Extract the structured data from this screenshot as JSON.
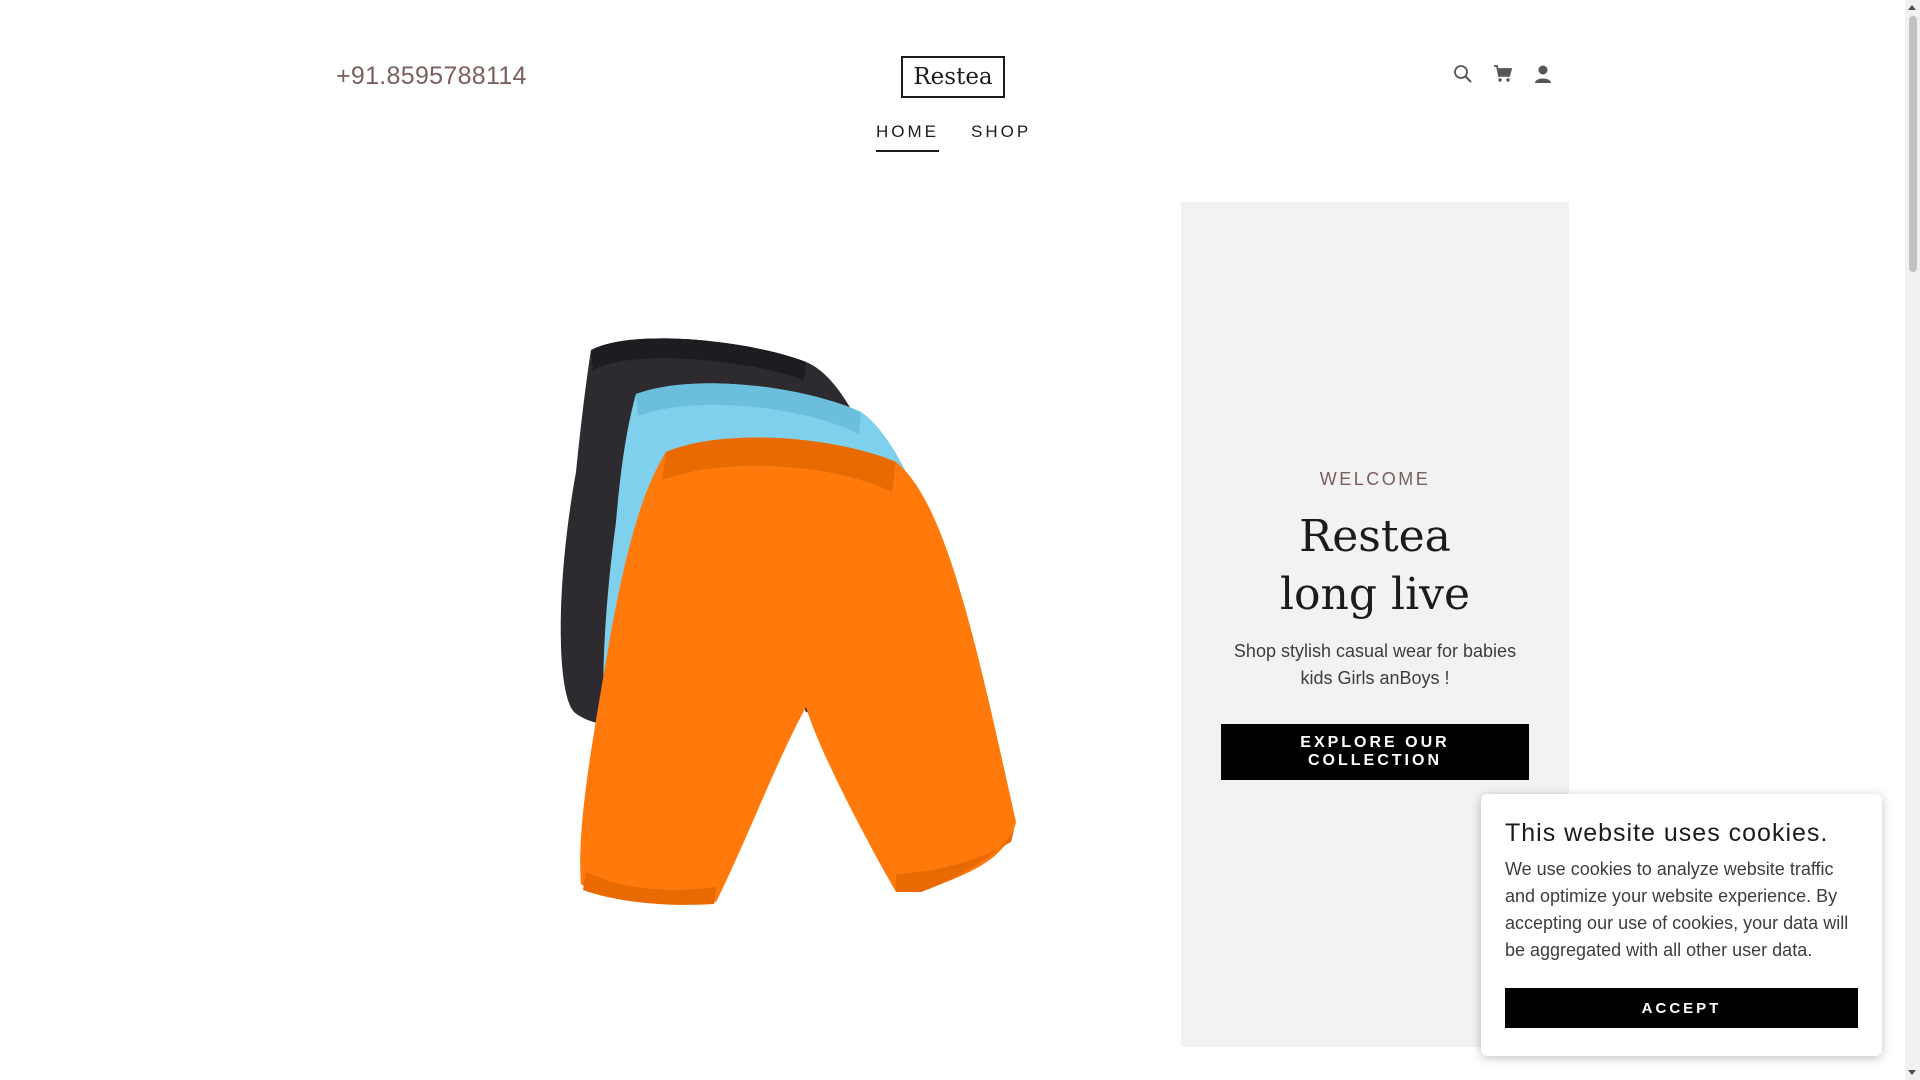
{
  "header": {
    "phone": "+91.8595788114",
    "logo": "Restea",
    "icons": [
      "search-icon",
      "cart-icon",
      "account-icon"
    ]
  },
  "nav": {
    "items": [
      {
        "label": "HOME",
        "active": true
      },
      {
        "label": "SHOP",
        "active": false
      }
    ]
  },
  "hero": {
    "image": "three-shorts-black-blue-orange",
    "welcome": "WELCOME",
    "headline_line1": "Restea",
    "headline_line2": "long live",
    "tagline_line1": "Shop stylish casual wear for babies",
    "tagline_line2": "kids Girls anBoys !",
    "button_line1": "EXPLORE OUR",
    "button_line2": "COLLECTION"
  },
  "cookie": {
    "title": "This website uses cookies.",
    "body": "We use cookies to analyze website traffic and optimize your website experience. By accepting our use of cookies, your data will be aggregated with all other user data.",
    "accept": "ACCEPT"
  },
  "colors": {
    "accent_text": "#7a5f5f",
    "panel_bg": "#f2f2f2",
    "button_bg": "#000000",
    "shorts_black": "#2e2b30",
    "shorts_blue": "#7fd0ec",
    "shorts_orange": "#ff7a0a"
  }
}
